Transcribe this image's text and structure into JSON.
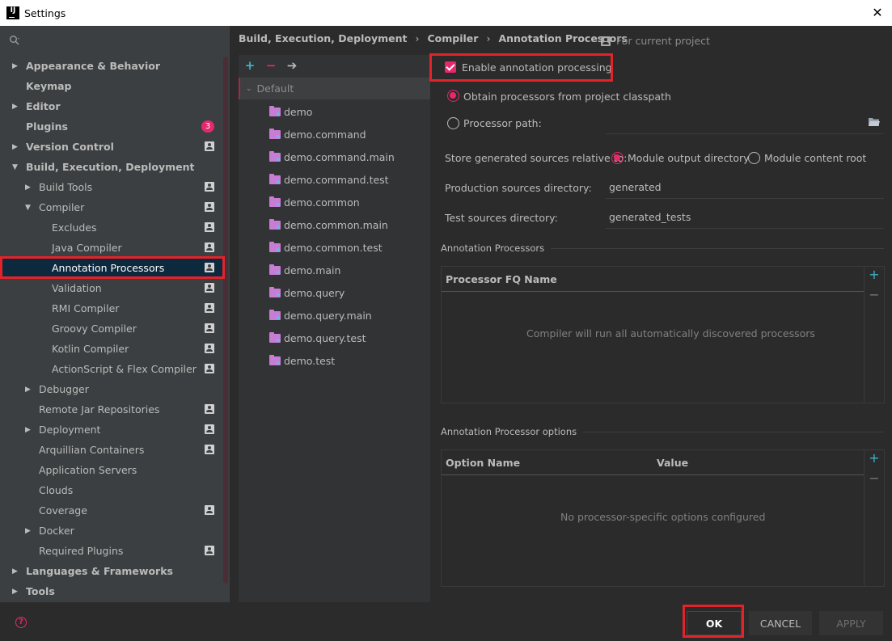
{
  "window": {
    "title": "Settings",
    "logo_text": "IJ"
  },
  "sidebar": {
    "items": [
      {
        "label": "Appearance & Behavior",
        "bold": true,
        "arrow": "right"
      },
      {
        "label": "Keymap",
        "bold": true
      },
      {
        "label": "Editor",
        "bold": true,
        "arrow": "right"
      },
      {
        "label": "Plugins",
        "bold": true,
        "badge": "3"
      },
      {
        "label": "Version Control",
        "bold": true,
        "arrow": "right",
        "project": true
      },
      {
        "label": "Build, Execution, Deployment",
        "bold": true,
        "arrow": "down"
      },
      {
        "label": "Build Tools",
        "arrow": "right",
        "project": true
      },
      {
        "label": "Compiler",
        "arrow": "down",
        "project": true
      },
      {
        "label": "Excludes",
        "project": true
      },
      {
        "label": "Java Compiler",
        "project": true
      },
      {
        "label": "Annotation Processors",
        "project": true,
        "selected": true
      },
      {
        "label": "Validation",
        "project": true
      },
      {
        "label": "RMI Compiler",
        "project": true
      },
      {
        "label": "Groovy Compiler",
        "project": true
      },
      {
        "label": "Kotlin Compiler",
        "project": true
      },
      {
        "label": "ActionScript & Flex Compiler",
        "project": true
      },
      {
        "label": "Debugger",
        "arrow": "right"
      },
      {
        "label": "Remote Jar Repositories",
        "project": true
      },
      {
        "label": "Deployment",
        "arrow": "right",
        "project": true
      },
      {
        "label": "Arquillian Containers",
        "project": true
      },
      {
        "label": "Application Servers"
      },
      {
        "label": "Clouds"
      },
      {
        "label": "Coverage",
        "project": true
      },
      {
        "label": "Docker",
        "arrow": "right"
      },
      {
        "label": "Required Plugins",
        "project": true
      },
      {
        "label": "Languages & Frameworks",
        "bold": true,
        "arrow": "right"
      },
      {
        "label": "Tools",
        "bold": true,
        "arrow": "right"
      }
    ]
  },
  "breadcrumb": [
    "Build, Execution, Deployment",
    "Compiler",
    "Annotation Processors"
  ],
  "scope_label": "For current project",
  "modules": {
    "default_label": "Default",
    "items": [
      "demo",
      "demo.command",
      "demo.command.main",
      "demo.command.test",
      "demo.common",
      "demo.common.main",
      "demo.common.test",
      "demo.main",
      "demo.query",
      "demo.query.main",
      "demo.query.test",
      "demo.test"
    ]
  },
  "settings": {
    "enable_label": "Enable annotation processing",
    "obtain_label": "Obtain processors from project classpath",
    "processor_path_label": "Processor path:",
    "store_label": "Store generated sources relative to:",
    "module_output_label": "Module output directory",
    "module_content_label": "Module content root",
    "production_label": "Production sources directory:",
    "production_value": "generated",
    "test_label": "Test sources directory:",
    "test_value": "generated_tests"
  },
  "processors_section": {
    "title": "Annotation Processors",
    "column": "Processor FQ Name",
    "empty": "Compiler will run all automatically discovered processors"
  },
  "options_section": {
    "title": "Annotation Processor options",
    "col_name": "Option Name",
    "col_value": "Value",
    "empty": "No processor-specific options configured"
  },
  "footer": {
    "ok": "OK",
    "cancel": "CANCEL",
    "apply": "APPLY"
  },
  "colors": {
    "accent": "#e6296c",
    "highlight": "#e3232a",
    "folder": "#c77dd4"
  }
}
